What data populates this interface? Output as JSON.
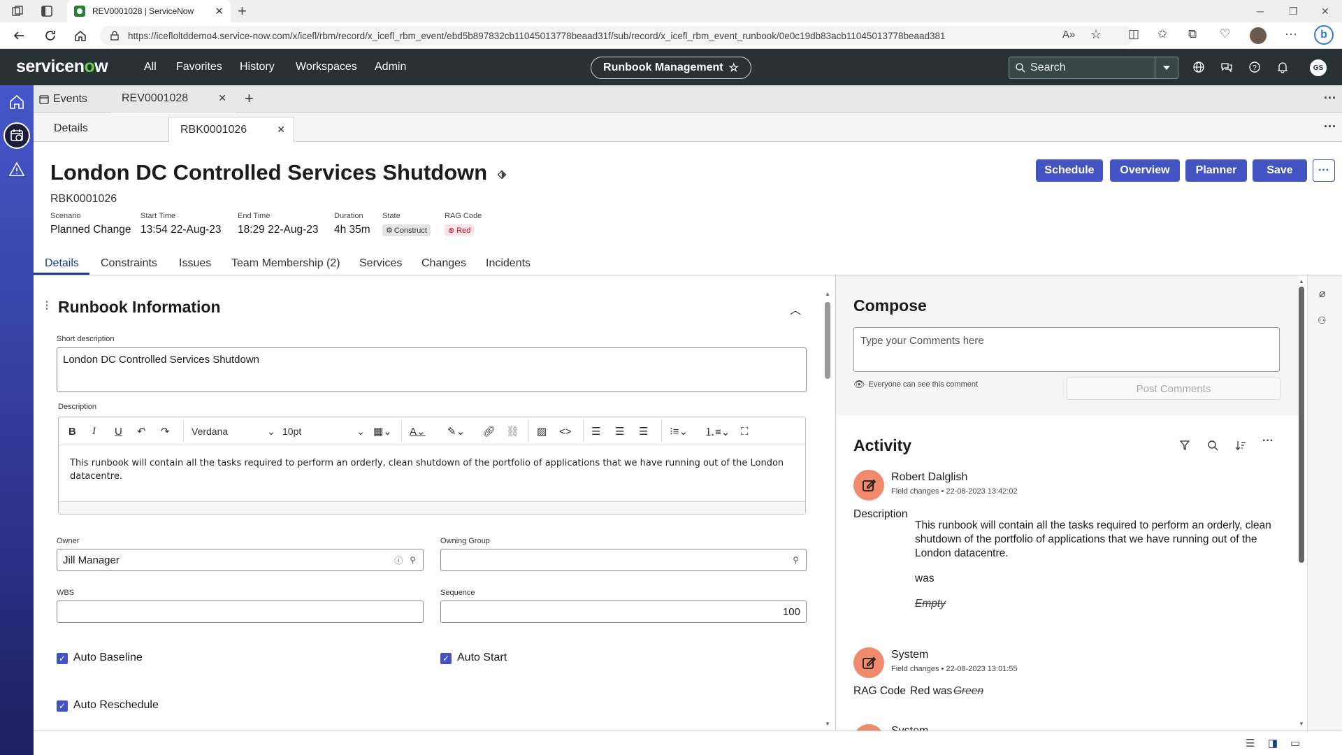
{
  "browser": {
    "tab_title": "REV0001028 | ServiceNow",
    "url": "https://icefloltddemo4.service-now.com/x/icefl/rbm/record/x_icefl_rbm_event/ebd5b897832cb11045013778beaad31f/sub/record/x_icefl_rbm_event_runbook/0e0c19db83acb11045013778beaad381"
  },
  "header": {
    "logo_prefix": "servicen",
    "logo_o": "o",
    "logo_suffix": "w",
    "menu": [
      "All",
      "Favorites",
      "History",
      "Workspaces",
      "Admin"
    ],
    "app_pill": "Runbook Management",
    "search_placeholder": "Search",
    "avatar_initials": "GS"
  },
  "workspace_tabs": {
    "tab1": "Events",
    "tab2": "REV0001028"
  },
  "sub_tabs": {
    "tab1": "Details",
    "tab2": "RBK0001026"
  },
  "record": {
    "title": "London DC Controlled Services Shutdown",
    "number": "RBK0001026",
    "meta": [
      {
        "label": "Scenario",
        "value": "Planned Change"
      },
      {
        "label": "Start Time",
        "value": "13:54 22-Aug-23"
      },
      {
        "label": "End Time",
        "value": "18:29 22-Aug-23"
      },
      {
        "label": "Duration",
        "value": "4h 35m"
      },
      {
        "label": "State",
        "value": "Construct"
      },
      {
        "label": "RAG Code",
        "value": "Red"
      }
    ],
    "buttons": [
      "Schedule",
      "Overview",
      "Planner",
      "Save"
    ],
    "tabs": [
      "Details",
      "Constraints",
      "Issues",
      "Team Membership (2)",
      "Services",
      "Changes",
      "Incidents"
    ]
  },
  "form": {
    "section_title": "Runbook Information",
    "short_description_label": "Short description",
    "short_description": "London DC Controlled Services Shutdown",
    "description_label": "Description",
    "font_name": "Verdana",
    "font_size": "10pt",
    "description": "This runbook will contain all the tasks required to perform an orderly, clean shutdown of the portfolio of applications that we have running out of the London datacentre.",
    "owner_label": "Owner",
    "owner": "Jill Manager",
    "owning_group_label": "Owning Group",
    "owning_group": "",
    "wbs_label": "WBS",
    "wbs": "",
    "sequence_label": "Sequence",
    "sequence": "100",
    "auto_baseline": "Auto Baseline",
    "auto_start": "Auto Start",
    "auto_reschedule": "Auto Reschedule"
  },
  "compose": {
    "title": "Compose",
    "placeholder": "Type your Comments here",
    "visibility": "Everyone can see this comment",
    "post_button": "Post Comments"
  },
  "activity": {
    "title": "Activity",
    "entries": [
      {
        "author": "Robert Dalglish",
        "meta": "Field changes • 22-08-2023 13:42:02",
        "field": "Description",
        "new_value": "This runbook will contain all the tasks required to perform an orderly, clean shutdown of the portfolio of applications that we have running out of the London datacentre.",
        "was": "was",
        "old_value": "Empty"
      },
      {
        "author": "System",
        "meta": "Field changes • 22-08-2023 13:01:55",
        "field": "RAG Code",
        "new_value": "Red was",
        "old_value": "Green"
      },
      {
        "author": "System"
      }
    ]
  },
  "colors": {
    "primary": "#4353c1",
    "header_bg": "#293134",
    "avatar_orange": "#f08a6c",
    "rag_red": "#e0394f"
  }
}
